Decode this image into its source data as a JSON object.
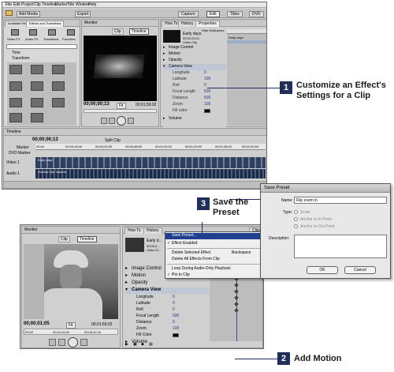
{
  "callouts": {
    "c1": {
      "num": "1",
      "text": "Customize an Effect's Settings for a Clip"
    },
    "c2": {
      "num": "2",
      "text": "Add Motion"
    },
    "c3": {
      "num": "3",
      "text": "Save the Preset"
    }
  },
  "top": {
    "menubar": [
      "File",
      "Edit",
      "Project",
      "Clip",
      "Timeline",
      "Marker",
      "Title",
      "Window",
      "Help"
    ],
    "toolbar": {
      "add_media": "Add Media",
      "export": "Export",
      "capture": "Capture",
      "edit": "Edit",
      "titles": "Titles",
      "dvd": "DVD"
    },
    "effects_panel": {
      "tabs": [
        "Available Media",
        "Effects and Transitions"
      ],
      "categories": [
        "Video FX",
        "Audio FX",
        "Transitions",
        "Favorites"
      ],
      "tree": [
        "Time",
        "Transform"
      ],
      "search": ""
    },
    "monitor": {
      "title": "Monitor",
      "clip_tab": "Clip",
      "timeline_tab": "Timeline",
      "timecode": "00;00;00;13",
      "fit": "Fit",
      "duration": "00;01;59;02"
    },
    "properties": {
      "tabs": [
        "How To",
        "History",
        "Properties"
      ],
      "hide_keyframes": "Hide Keyframes",
      "clip_name": "Early days",
      "clip_info": [
        "00;00;29;21",
        "Video Clip"
      ],
      "sections": [
        "Image Control",
        "Motion",
        "Opacity",
        "Camera View"
      ],
      "params": [
        {
          "name": "Longitude",
          "value": "0"
        },
        {
          "name": "Latitude",
          "value": "100"
        },
        {
          "name": "Roll",
          "value": "0"
        },
        {
          "name": "Focal Length",
          "value": "500"
        },
        {
          "name": "Distance",
          "value": "500"
        },
        {
          "name": "Zoom",
          "value": "100"
        },
        {
          "name": "Fill color",
          "value": ""
        }
      ],
      "volume": "Volume",
      "kf_clip": "Early days"
    },
    "timeline": {
      "title": "Timeline",
      "timecode": "00;00;00;13",
      "split_clip": "Split Clip",
      "marker": "Marker",
      "dvd_marker": "DVD Marker",
      "ruler": [
        "00;00",
        "00;00;16;00",
        "00;00;32;00",
        "00;00;48;00",
        "00;01;04;02",
        "00;01;20;02",
        "00;01;36;02",
        "00;01;52;04"
      ],
      "tracks": [
        "Video 1",
        "Audio 1"
      ],
      "clip_label": "Early days",
      "audio_label": "Volume:Clip Volume"
    }
  },
  "bottom": {
    "monitor": {
      "title": "Monitor",
      "clip_tab": "Clip",
      "timeline_tab": "Timeline",
      "timecode": "00;00;01;05",
      "fit": "Fit",
      "duration": "00;01;59;02",
      "ruler": [
        "00;00",
        "00;04;16;00",
        "00;08;32;16"
      ]
    },
    "properties": {
      "tabs": [
        "How To",
        "History"
      ],
      "clip_name": "Early d...",
      "clip_info": [
        "00;00;2...",
        "Video Cl..."
      ],
      "sections": [
        "Image Control",
        "Motion",
        "Opacity",
        "Camera View"
      ],
      "params": [
        {
          "name": "Longitude",
          "value": "0"
        },
        {
          "name": "Latitude",
          "value": "0"
        },
        {
          "name": "Roll",
          "value": "0"
        },
        {
          "name": "Focal Length",
          "value": "500"
        },
        {
          "name": "Distance",
          "value": "0"
        },
        {
          "name": "Zoom",
          "value": "100"
        },
        {
          "name": "Fill Color",
          "value": ""
        }
      ],
      "volume": "Volume",
      "clip_tab": "Clips"
    },
    "context_menu": {
      "items": [
        "Save Preset...",
        "Effect Enabled",
        "Delete Selected Effect",
        "Delete All Effects From Clip",
        "Loop During Audio-Only Playback",
        "Pin to Clip"
      ],
      "shortcut": "Backspace"
    },
    "dialog": {
      "title": "Save Preset",
      "name_label": "Name:",
      "name_value": "Flip zoom in",
      "type_label": "Type:",
      "types": [
        "Scale",
        "Anchor to In Point",
        "Anchor to Out Point"
      ],
      "desc_label": "Description:",
      "ok": "OK",
      "cancel": "Cancel"
    }
  },
  "colors": {
    "callout_bg": "#1f2f5a",
    "panel_bg": "#d4d4d4",
    "dark_panel": "#5a5a5a",
    "timeline_blue": "#3a4f7a"
  }
}
